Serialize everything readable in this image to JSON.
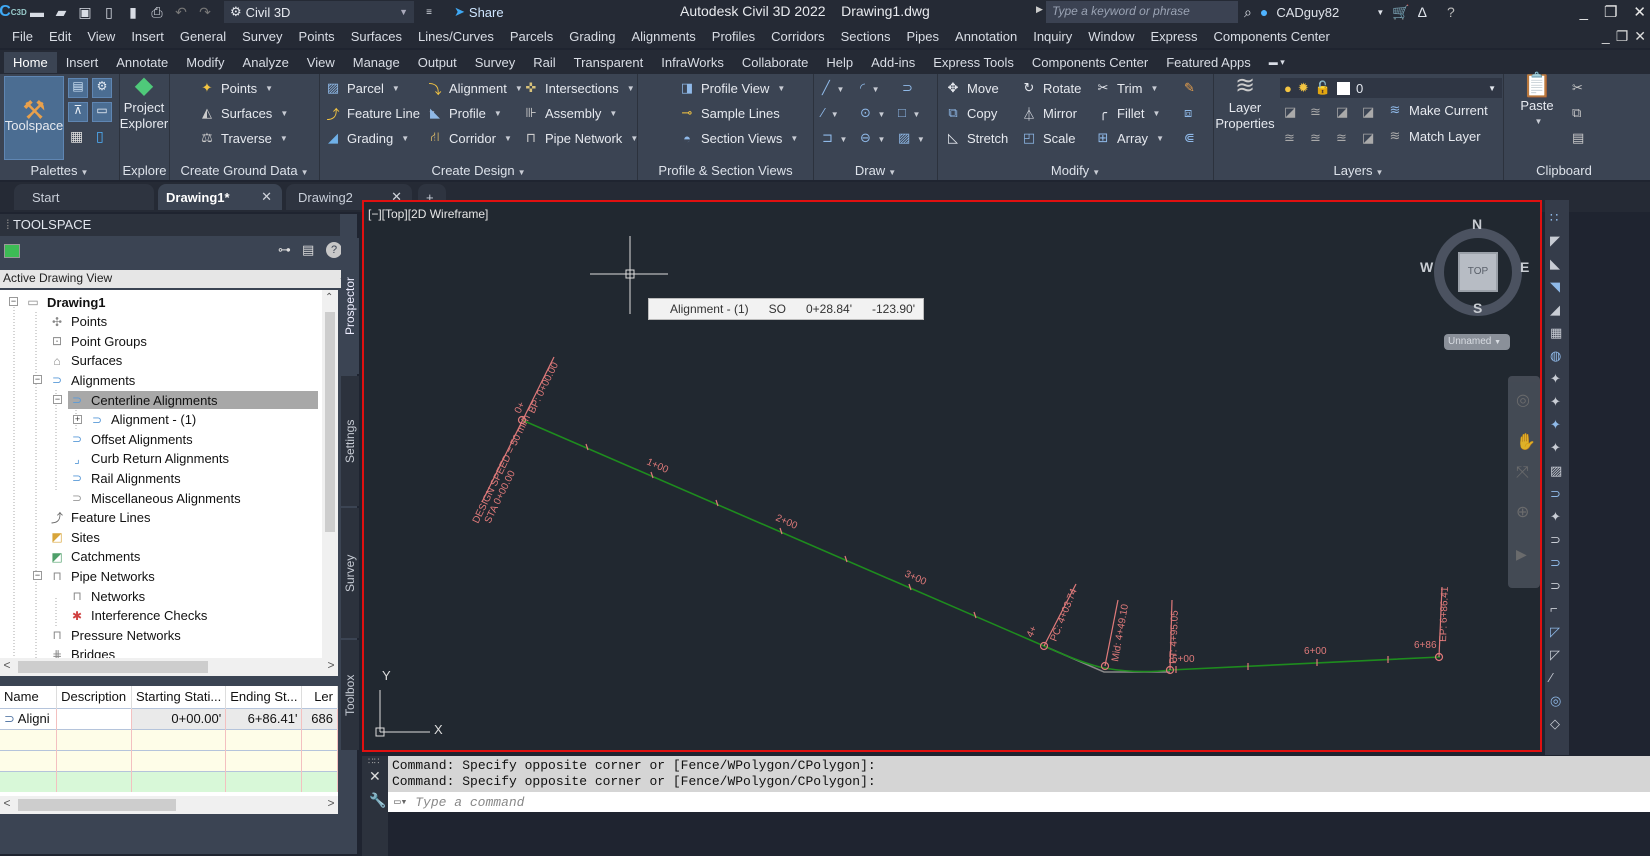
{
  "titlebar": {
    "app_logo": "C",
    "app_logo_sub": "C3D",
    "workspace": "Civil 3D",
    "share_label": "Share",
    "title": "Autodesk Civil 3D 2022    Drawing1.dwg",
    "search_placeholder": "Type a keyword or phrase",
    "user": "CADguy82"
  },
  "menubar": [
    "File",
    "Edit",
    "View",
    "Insert",
    "General",
    "Survey",
    "Points",
    "Surfaces",
    "Lines/Curves",
    "Parcels",
    "Grading",
    "Alignments",
    "Profiles",
    "Corridors",
    "Sections",
    "Pipes",
    "Annotation",
    "Inquiry",
    "Window",
    "Express",
    "Components Center"
  ],
  "ribbon_tabs": [
    "Home",
    "Insert",
    "Annotate",
    "Modify",
    "Analyze",
    "View",
    "Manage",
    "Output",
    "Survey",
    "Rail",
    "Transparent",
    "InfraWorks",
    "Collaborate",
    "Help",
    "Add-ins",
    "Express Tools",
    "Components Center",
    "Featured Apps"
  ],
  "ribbon": {
    "palettes": {
      "title": "Palettes",
      "toolspace": "Toolspace"
    },
    "explore": {
      "title": "Explore",
      "project_explorer_1": "Project",
      "project_explorer_2": "Explorer"
    },
    "ground": {
      "title": "Create Ground Data",
      "items": [
        "Points",
        "Surfaces",
        "Traverse"
      ]
    },
    "design": {
      "title": "Create Design",
      "col1": [
        "Parcel",
        "Feature Line",
        "Grading"
      ],
      "col2": [
        "Alignment",
        "Profile",
        "Corridor"
      ],
      "col3": [
        "Intersections",
        "Assembly",
        "Pipe Network"
      ]
    },
    "psv": {
      "title": "Profile & Section Views",
      "items": [
        "Profile View",
        "Sample Lines",
        "Section Views"
      ]
    },
    "draw": {
      "title": "Draw"
    },
    "modify": {
      "title": "Modify",
      "col1": [
        "Move",
        "Copy",
        "Stretch"
      ],
      "col2": [
        "Rotate",
        "Mirror",
        "Scale"
      ],
      "col3": [
        "Trim",
        "Fillet",
        "Array"
      ]
    },
    "layers": {
      "title": "Layers",
      "layer_props_1": "Layer",
      "layer_props_2": "Properties",
      "current_layer": "0",
      "make_current": "Make Current",
      "match_layer": "Match Layer"
    },
    "clipboard": {
      "title": "Clipboard",
      "paste": "Paste"
    }
  },
  "doc_tabs": [
    {
      "label": "Start"
    },
    {
      "label": "Drawing1*",
      "active": true
    },
    {
      "label": "Drawing2"
    }
  ],
  "toolspace": {
    "title": "TOOLSPACE",
    "view": "Active Drawing View",
    "tree": [
      {
        "label": "Drawing1",
        "level": 0,
        "bold": true,
        "expander": "−"
      },
      {
        "label": "Points",
        "level": 1
      },
      {
        "label": "Point Groups",
        "level": 1
      },
      {
        "label": "Surfaces",
        "level": 1
      },
      {
        "label": "Alignments",
        "level": 1,
        "expander": "−"
      },
      {
        "label": "Centerline Alignments",
        "level": 2,
        "expander": "−",
        "selected": true
      },
      {
        "label": "Alignment - (1)",
        "level": 3,
        "expander": "+"
      },
      {
        "label": "Offset Alignments",
        "level": 2
      },
      {
        "label": "Curb Return Alignments",
        "level": 2
      },
      {
        "label": "Rail Alignments",
        "level": 2
      },
      {
        "label": "Miscellaneous Alignments",
        "level": 2
      },
      {
        "label": "Feature Lines",
        "level": 1
      },
      {
        "label": "Sites",
        "level": 1
      },
      {
        "label": "Catchments",
        "level": 1
      },
      {
        "label": "Pipe Networks",
        "level": 1,
        "expander": "−"
      },
      {
        "label": "Networks",
        "level": 2
      },
      {
        "label": "Interference Checks",
        "level": 2
      },
      {
        "label": "Pressure Networks",
        "level": 1
      },
      {
        "label": "Bridges",
        "level": 1
      }
    ],
    "vertical_tabs": [
      "Prospector",
      "Settings",
      "Survey",
      "Toolbox"
    ],
    "list": {
      "columns": [
        "Name",
        "Description",
        "Starting Stati...",
        "Ending St...",
        "Ler"
      ],
      "rows": [
        [
          "Aligni",
          "",
          "0+00.00'",
          "6+86.41'",
          "686"
        ]
      ]
    }
  },
  "viewport": {
    "label": "[−][Top][2D Wireframe]",
    "tooltip": {
      "name": "Alignment - (1)",
      "so": "SO",
      "station": "0+28.84'",
      "offset": "-123.90'"
    },
    "viewcube": {
      "n": "N",
      "s": "S",
      "e": "E",
      "w": "W",
      "face": "TOP",
      "ucs": "Unnamed"
    },
    "labels": {
      "design_speed": "DESIGN SPEED = 50 mi/h",
      "sta_start": "STA 0+00.00",
      "bp": "BP: 0+00.00",
      "bp_small": "0+",
      "sta1": "1+00",
      "sta2": "2+00",
      "sta3": "3+00",
      "sta4": "4+",
      "pc": "PC: 4+03.74",
      "mid": "Mid: 4+49.10",
      "pt": "PT: 4+95.05",
      "sta5": "5+00",
      "sta6": "6+00",
      "ep": "EP: 6+86.41",
      "sta_end": "6+86",
      "ucs_x": "X",
      "ucs_y": "Y"
    }
  },
  "command": {
    "history": [
      "Command: Specify opposite corner or [Fence/WPolygon/CPolygon]:",
      "Command: Specify opposite corner or [Fence/WPolygon/CPolygon]:"
    ],
    "placeholder": "Type a command"
  },
  "colors": {
    "accent_red": "#e01010",
    "alignment_green": "#1e8c1e",
    "label_pink": "#e07a7a"
  }
}
